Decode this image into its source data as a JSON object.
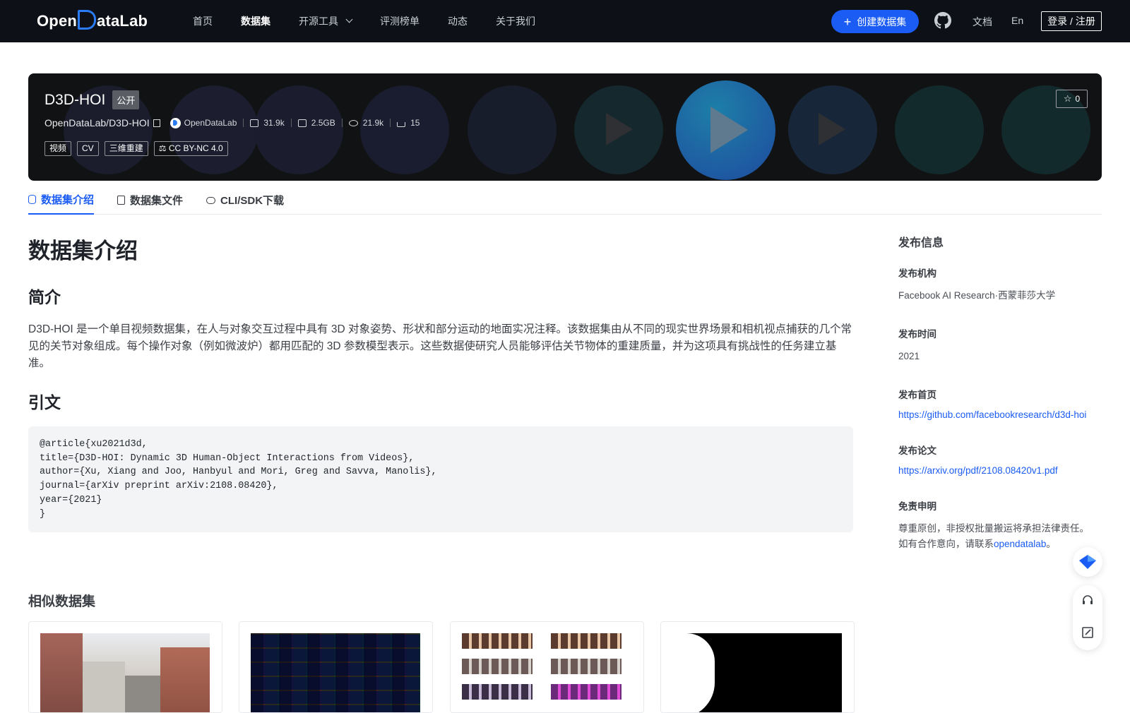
{
  "nav": {
    "logo_text": "OpenDataLab",
    "links": [
      {
        "label": "首页",
        "active": false
      },
      {
        "label": "数据集",
        "active": true
      },
      {
        "label": "开源工具",
        "active": false
      },
      {
        "label": "评测榜单",
        "active": false
      },
      {
        "label": "动态",
        "active": false
      },
      {
        "label": "关于我们",
        "active": false
      }
    ],
    "create_button": "创建数据集",
    "docs": "文档",
    "lang": "En",
    "login": "登录 / 注册"
  },
  "dataset": {
    "name": "D3D-HOI",
    "visibility": "公开",
    "path": "OpenDataLab/D3D-HOI",
    "org": "OpenDataLab",
    "files": "31.9k",
    "size": "2.5GB",
    "views": "21.9k",
    "downloads": "15",
    "tags": [
      "视频",
      "CV",
      "三维重建"
    ],
    "license": "CC BY-NC 4.0",
    "stars": "0"
  },
  "tabs": [
    {
      "label": "数据集介绍",
      "active": true
    },
    {
      "label": "数据集文件",
      "active": false
    },
    {
      "label": "CLI/SDK下载",
      "active": false
    }
  ],
  "main": {
    "title": "数据集介绍",
    "intro_heading": "简介",
    "intro_text": "D3D-HOI 是一个单目视频数据集，在人与对象交互过程中具有 3D 对象姿势、形状和部分运动的地面实况注释。该数据集由从不同的现实世界场景和相机视点捕获的几个常见的关节对象组成。每个操作对象（例如微波炉）都用匹配的 3D 参数模型表示。这些数据使研究人员能够评估关节物体的重建质量，并为这项具有挑战性的任务建立基准。",
    "citation_heading": "引文",
    "citation_lines": [
      "@article{xu2021d3d,",
      "title={D3D-HOI: Dynamic 3D Human-Object Interactions from Videos},",
      "author={Xu, Xiang and Joo, Hanbyul and Mori, Greg and Savva, Manolis},",
      "journal={arXiv preprint arXiv:2108.08420},",
      "year={2021}",
      "}"
    ]
  },
  "sidebar": {
    "title": "发布信息",
    "org_label": "发布机构",
    "org_value": "Facebook AI Research·西蒙菲莎大学",
    "time_label": "发布时间",
    "time_value": "2021",
    "home_label": "发布首页",
    "home_value": "https://github.com/facebookresearch/d3d-hoi",
    "paper_label": "发布论文",
    "paper_value": "https://arxiv.org/pdf/2108.08420v1.pdf",
    "disclaimer_label": "免责申明",
    "disclaimer_line1": "尊重原创，非授权批量搬运将承担法律责任。",
    "disclaimer_line2_pre": "如有合作意向，请联系",
    "disclaimer_link": "opendatalab",
    "disclaimer_line2_post": "。"
  },
  "similar": {
    "title": "相似数据集"
  },
  "colors": {
    "nav_bg": "#0d1117",
    "accent": "#1b5cf5",
    "hero_bg": "#111214"
  },
  "icons": [
    "github-icon",
    "plus-icon",
    "star-icon",
    "copy-icon",
    "eye-icon",
    "download-icon",
    "file-icon",
    "disk-icon",
    "license-icon",
    "headset-icon",
    "edit-icon",
    "ai-assistant-icon"
  ]
}
